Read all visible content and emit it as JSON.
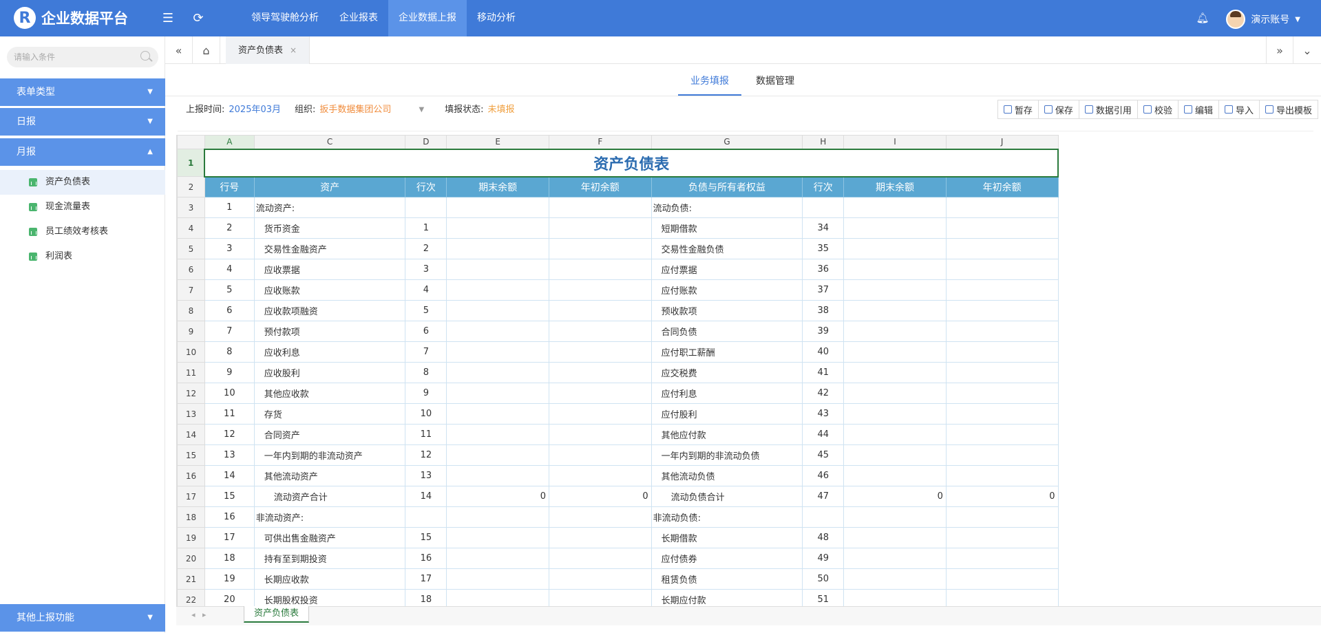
{
  "app": {
    "title": "企业数据平台",
    "logo_letter": "R"
  },
  "topnav": [
    {
      "label": "领导驾驶舱分析"
    },
    {
      "label": "企业报表"
    },
    {
      "label": "企业数据上报",
      "active": true
    },
    {
      "label": "移动分析"
    }
  ],
  "user": {
    "name": "演示账号"
  },
  "sidebar": {
    "search_placeholder": "请输入条件",
    "groups": [
      {
        "label": "表单类型"
      },
      {
        "label": "日报"
      },
      {
        "label": "月报"
      }
    ],
    "items": [
      {
        "label": "资产负债表",
        "active": true
      },
      {
        "label": "现金流量表"
      },
      {
        "label": "员工绩效考核表"
      },
      {
        "label": "利润表"
      }
    ],
    "footer": "其他上报功能"
  },
  "tab": {
    "label": "资产负债表"
  },
  "subtabs": [
    {
      "label": "业务填报",
      "active": true
    },
    {
      "label": "数据管理"
    }
  ],
  "info": {
    "time_label": "上报时间:",
    "time_value": "2025年03月",
    "org_label": "组织:",
    "org_value": "扳手数据集团公司",
    "status_label": "填报状态:",
    "status_value": "未填报"
  },
  "tools": [
    {
      "label": "暂存",
      "icon": "save-draft-icon"
    },
    {
      "label": "保存",
      "icon": "save-icon"
    },
    {
      "label": "数据引用",
      "icon": "reference-icon"
    },
    {
      "label": "校验",
      "icon": "check-icon"
    },
    {
      "label": "编辑",
      "icon": "edit-icon"
    },
    {
      "label": "导入",
      "icon": "import-icon"
    },
    {
      "label": "导出模板",
      "icon": "export-icon"
    }
  ],
  "sheet": {
    "columns": [
      "A",
      "C",
      "D",
      "E",
      "F",
      "G",
      "H",
      "I",
      "J"
    ],
    "title": "资产负债表",
    "headers": [
      "行号",
      "资产",
      "行次",
      "期末余额",
      "年初余额",
      "负债与所有者权益",
      "行次",
      "期末余额",
      "年初余额"
    ],
    "rows": [
      [
        "1",
        "流动资产:",
        "",
        "",
        "",
        "流动负债:",
        "",
        "",
        ""
      ],
      [
        "2",
        "货币资金",
        "1",
        "",
        "",
        "短期借款",
        "34",
        "",
        ""
      ],
      [
        "3",
        "交易性金融资产",
        "2",
        "",
        "",
        "交易性金融负债",
        "35",
        "",
        ""
      ],
      [
        "4",
        "应收票据",
        "3",
        "",
        "",
        "应付票据",
        "36",
        "",
        ""
      ],
      [
        "5",
        "应收账款",
        "4",
        "",
        "",
        "应付账款",
        "37",
        "",
        ""
      ],
      [
        "6",
        "应收款项融资",
        "5",
        "",
        "",
        "预收款项",
        "38",
        "",
        ""
      ],
      [
        "7",
        "预付款项",
        "6",
        "",
        "",
        "合同负债",
        "39",
        "",
        ""
      ],
      [
        "8",
        "应收利息",
        "7",
        "",
        "",
        "应付职工薪酬",
        "40",
        "",
        ""
      ],
      [
        "9",
        "应收股利",
        "8",
        "",
        "",
        "应交税费",
        "41",
        "",
        ""
      ],
      [
        "10",
        "其他应收款",
        "9",
        "",
        "",
        "应付利息",
        "42",
        "",
        ""
      ],
      [
        "11",
        "存货",
        "10",
        "",
        "",
        "应付股利",
        "43",
        "",
        ""
      ],
      [
        "12",
        "合同资产",
        "11",
        "",
        "",
        "其他应付款",
        "44",
        "",
        ""
      ],
      [
        "13",
        "一年内到期的非流动资产",
        "12",
        "",
        "",
        "一年内到期的非流动负债",
        "45",
        "",
        ""
      ],
      [
        "14",
        "其他流动资产",
        "13",
        "",
        "",
        "其他流动负债",
        "46",
        "",
        ""
      ],
      [
        "15",
        "流动资产合计",
        "14",
        "0",
        "0",
        "流动负债合计",
        "47",
        "0",
        "0"
      ],
      [
        "16",
        "非流动资产:",
        "",
        "",
        "",
        "非流动负债:",
        "",
        "",
        ""
      ],
      [
        "17",
        "可供出售金融资产",
        "15",
        "",
        "",
        "长期借款",
        "48",
        "",
        ""
      ],
      [
        "18",
        "持有至到期投资",
        "16",
        "",
        "",
        "应付债券",
        "49",
        "",
        ""
      ],
      [
        "19",
        "长期应收款",
        "17",
        "",
        "",
        "租赁负债",
        "50",
        "",
        ""
      ],
      [
        "20",
        "长期股权投资",
        "18",
        "",
        "",
        "长期应付款",
        "51",
        "",
        ""
      ]
    ],
    "sheet_tab": "资产负债表"
  }
}
